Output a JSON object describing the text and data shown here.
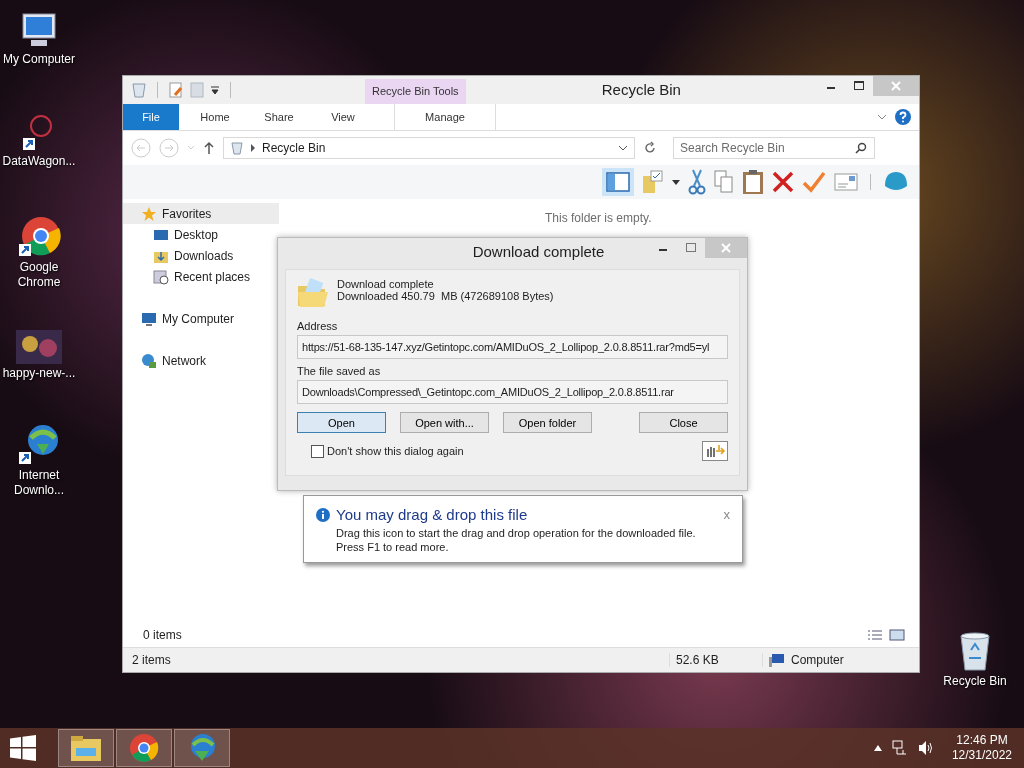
{
  "desktop_icons": [
    {
      "label": "My Computer",
      "kind": "computer"
    },
    {
      "label": "DataWagon...",
      "kind": "shortcut"
    },
    {
      "label": "Google Chrome",
      "kind": "chrome"
    },
    {
      "label": "happy-new-...",
      "kind": "image"
    },
    {
      "label": "Internet Downlo...",
      "kind": "idm"
    },
    {
      "label": "Recycle Bin",
      "kind": "recycle"
    }
  ],
  "explorer": {
    "title": "Recycle Bin",
    "contextual_group": "Recycle Bin Tools",
    "ribbon_tabs": [
      {
        "label": "File",
        "kind": "file"
      },
      {
        "label": "Home",
        "kind": "plain"
      },
      {
        "label": "Share",
        "kind": "plain"
      },
      {
        "label": "View",
        "kind": "plain"
      },
      {
        "label": "Manage",
        "kind": "contextual"
      }
    ],
    "address": "Recycle Bin",
    "search": {
      "placeholder": "Search Recycle Bin"
    },
    "nav": [
      {
        "label": "Favorites",
        "kind": "star",
        "selected": true,
        "children": [
          {
            "label": "Desktop",
            "kind": "desktop",
            "selected": false
          },
          {
            "label": "Downloads",
            "kind": "downloads",
            "selected": false
          },
          {
            "label": "Recent places",
            "kind": "recent",
            "selected": false
          }
        ]
      },
      {
        "label": "My Computer",
        "kind": "computer",
        "selected": false
      },
      {
        "label": "Network",
        "kind": "network",
        "selected": false
      }
    ],
    "empty_message": "This folder is empty.",
    "item_count": "0 items",
    "status_bar": {
      "items": "2 items",
      "size": "52.6 KB",
      "location": "Computer"
    }
  },
  "dialog": {
    "title": "Download complete",
    "heading": "Download complete",
    "detail": "Downloaded 450.79  MB (472689108 Bytes)",
    "address_label": "Address",
    "address": "https://51-68-135-147.xyz/Getintopc.com/AMIDuOS_2_Lollipop_2.0.8.8511.rar?md5=yl",
    "saved_label": "The file saved as",
    "saved": "Downloads\\Compressed\\_Getintopc.com_AMIDuOS_2_Lollipop_2.0.8.8511.rar",
    "buttons": [
      {
        "label": "Open",
        "default": true
      },
      {
        "label": "Open with...",
        "default": false
      },
      {
        "label": "Open folder",
        "default": false
      },
      {
        "label": "Close",
        "default": false
      }
    ],
    "dont_show": {
      "label": "Don't show this dialog again",
      "checked": false
    }
  },
  "tooltip": {
    "title": "You may drag & drop this file",
    "close": "x",
    "lines": [
      "Drag this icon to start the drag and drop operation for the downloaded file.",
      "Press F1 to read more."
    ]
  },
  "taskbar": {
    "apps": [
      {
        "kind": "explorer"
      },
      {
        "kind": "chrome"
      },
      {
        "kind": "idm"
      }
    ],
    "time": "12:46 PM",
    "date": "12/31/2022"
  }
}
